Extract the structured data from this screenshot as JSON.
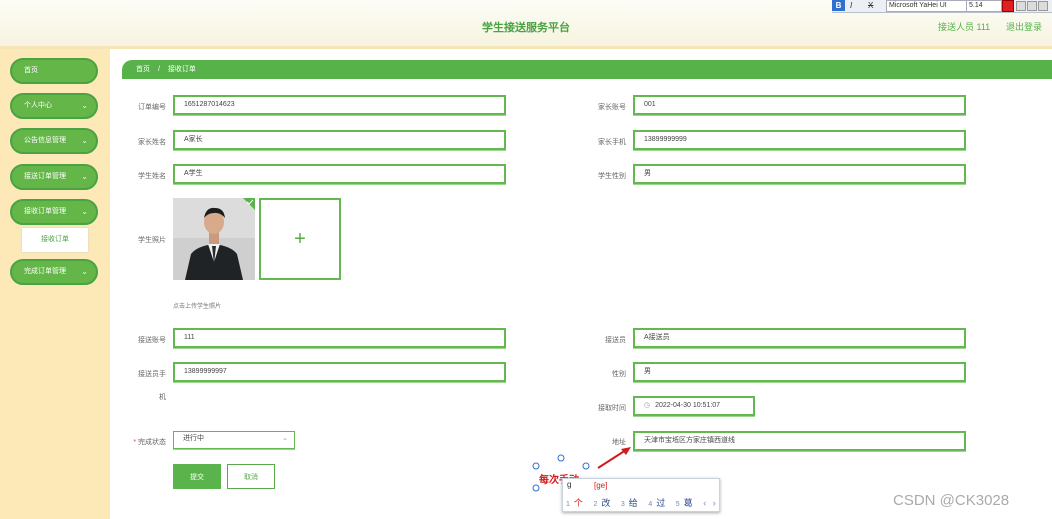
{
  "header": {
    "title": "学生接送服务平台",
    "user": "接送人员 111",
    "logout": "退出登录"
  },
  "format_toolbar": {
    "bold": "B",
    "italic": "I",
    "strike": "X",
    "font": "Microsoft YaHei UI",
    "size": "5.14"
  },
  "sidebar": {
    "items": [
      {
        "label": "首页"
      },
      {
        "label": "个人中心",
        "chevron": "⌄"
      },
      {
        "label": "公告信息管理",
        "chevron": "⌄"
      },
      {
        "label": "接送订单管理",
        "chevron": "⌄"
      },
      {
        "label": "接收订单管理",
        "chevron": "⌄"
      },
      {
        "label": "完成订单管理",
        "chevron": "⌄"
      }
    ],
    "submenu": {
      "label": "接收订单"
    }
  },
  "breadcrumb": {
    "home": "首页",
    "sep": "/",
    "current": "接收订单"
  },
  "form": {
    "order_no": {
      "label": "订单编号",
      "value": "1651287014623"
    },
    "parent_account": {
      "label": "家长账号",
      "value": "001"
    },
    "parent_name": {
      "label": "家长姓名",
      "value": "A家长"
    },
    "parent_phone": {
      "label": "家长手机",
      "value": "13899999999"
    },
    "student_name": {
      "label": "学生姓名",
      "value": "A学生"
    },
    "student_gender": {
      "label": "学生性别",
      "value": "男"
    },
    "student_photo": {
      "label": "学生照片",
      "hint": "点击上传学生照片",
      "upload": "+"
    },
    "driver_account": {
      "label": "接送账号",
      "value": "111"
    },
    "driver": {
      "label": "接送员",
      "value": "A接送员"
    },
    "driver_phone": {
      "label": "接送员手",
      "label2": "机",
      "value": "13899999997"
    },
    "gender": {
      "label": "性别",
      "value": "男"
    },
    "pickup_time": {
      "label": "接取时间",
      "value": "2022-04-30 10:51:07"
    },
    "status": {
      "required": "*",
      "label": "完成状态",
      "value": "进行中"
    },
    "address": {
      "label": "地址",
      "value": "天津市宝坻区方家庄镇西道线"
    },
    "submit": "提交",
    "cancel": "取消"
  },
  "annotation": {
    "text": "每次手动"
  },
  "ime": {
    "pinyin": "[ge]",
    "candidates": [
      {
        "n": "1",
        "text": "个"
      },
      {
        "n": "2",
        "text": "改"
      },
      {
        "n": "3",
        "text": "给"
      },
      {
        "n": "4",
        "text": "过"
      },
      {
        "n": "5",
        "text": "葛"
      }
    ],
    "caret": "g"
  },
  "watermark": "CSDN @CK3028",
  "colors": {
    "accent": "#58b24a",
    "sidebar": "#fde9b8",
    "annotation": "#d21c1c"
  }
}
